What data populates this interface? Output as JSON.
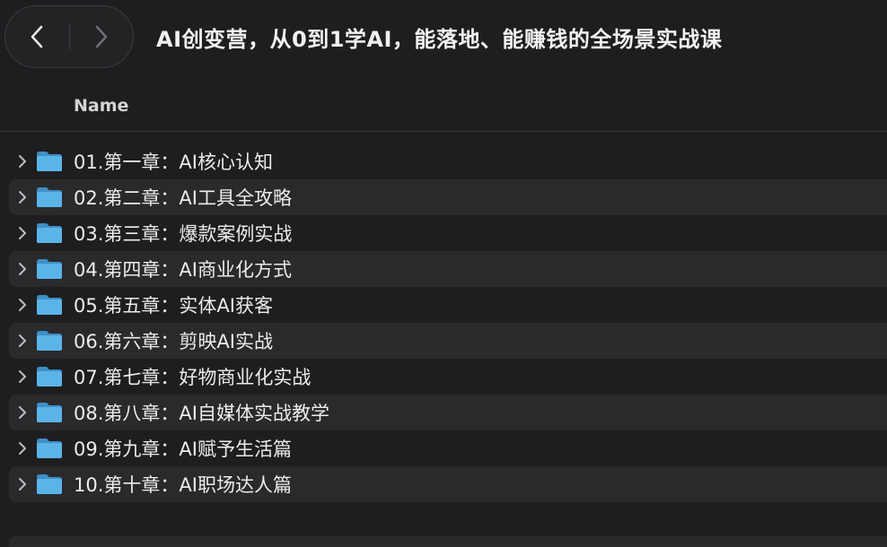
{
  "window": {
    "title": "AI创变营，从0到1学AI，能落地、能赚钱的全场景实战课"
  },
  "toolbar": {
    "back_icon": "chevron-left-icon",
    "forward_icon": "chevron-right-icon"
  },
  "columns": {
    "name": "Name"
  },
  "colors": {
    "background": "#1e1e20",
    "row_alt": "#2a2a2d",
    "folder": "#5ab4e8"
  },
  "files": [
    {
      "name": "01.第一章：AI核心认知",
      "icon": "folder-icon"
    },
    {
      "name": "02.第二章：AI工具全攻略",
      "icon": "folder-icon"
    },
    {
      "name": "03.第三章：爆款案例实战",
      "icon": "folder-icon"
    },
    {
      "name": "04.第四章：AI商业化方式",
      "icon": "folder-icon"
    },
    {
      "name": "05.第五章：实体AI获客",
      "icon": "folder-icon"
    },
    {
      "name": "06.第六章：剪映AI实战",
      "icon": "folder-icon"
    },
    {
      "name": "07.第七章：好物商业化实战",
      "icon": "folder-icon"
    },
    {
      "name": "08.第八章：AI自媒体实战教学",
      "icon": "folder-icon"
    },
    {
      "name": "09.第九章：AI赋予生活篇",
      "icon": "folder-icon"
    },
    {
      "name": "10.第十章：AI职场达人篇",
      "icon": "folder-icon"
    }
  ]
}
